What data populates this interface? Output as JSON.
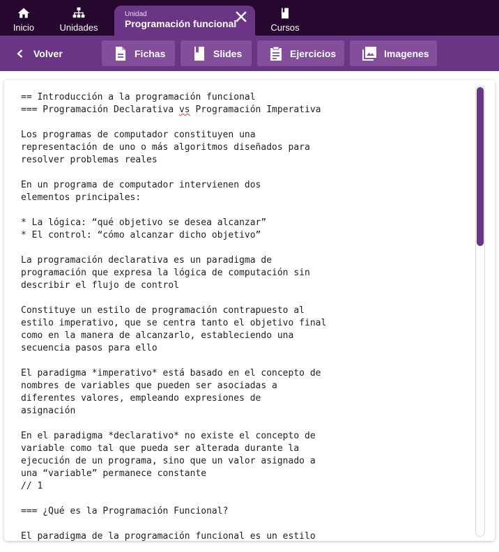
{
  "topnav": {
    "home_label": "Inicio",
    "units_label": "Unidades",
    "courses_label": "Cursos",
    "active_tab": {
      "caption": "Unidad",
      "title": "Programación funcional"
    }
  },
  "toolbar": {
    "back_label": "Volver",
    "buttons": [
      {
        "label": "Fichas",
        "icon": "document-icon"
      },
      {
        "label": "Slides",
        "icon": "book-icon"
      },
      {
        "label": "Ejercicios",
        "icon": "clipboard-icon"
      },
      {
        "label": "Imagenes",
        "icon": "photo-library-icon"
      }
    ]
  },
  "editor": {
    "lines": [
      "== Introducción a la programación funcional",
      "=== Programación Declarativa vs Programación Imperativa",
      "",
      "Los programas de computador constituyen una",
      "representación de uno o más algoritmos diseñados para",
      "resolver problemas reales",
      "",
      "En un programa de computador intervienen dos",
      "elementos principales:",
      "",
      "* La lógica: “qué objetivo se desea alcanzar”",
      "* El control: “cómo alcanzar dicho objetivo”",
      "",
      "La programación declarativa es un paradigma de",
      "programación que expresa la lógica de computación sin",
      "describir el flujo de control",
      "",
      "Constituye un estilo de programación contrapuesto al",
      "estilo imperativo, que se centra tanto el objetivo final",
      "como en la manera de alcanzarlo, estableciendo una",
      "secuencia pasos para ello",
      "",
      "El paradigma *imperativo* está basado en el concepto de",
      "nombres de variables que pueden ser asociadas a",
      "diferentes valores, empleando expresiones de",
      "asignación",
      "",
      "En el paradigma *declarativo* no existe el concepto de",
      "variable como tal que pueda ser alterada durante la",
      "ejecución de un programa, sino que un valor asignado a",
      "una “variable” permanece constante",
      "// 1",
      "",
      "=== ¿Qué es la Programación Funcional?",
      "",
      "El paradigma de la programación funcional es un estilo"
    ]
  },
  "colors": {
    "topbar": "#26072d",
    "accent": "#6b3585",
    "button": "#834f9a"
  }
}
